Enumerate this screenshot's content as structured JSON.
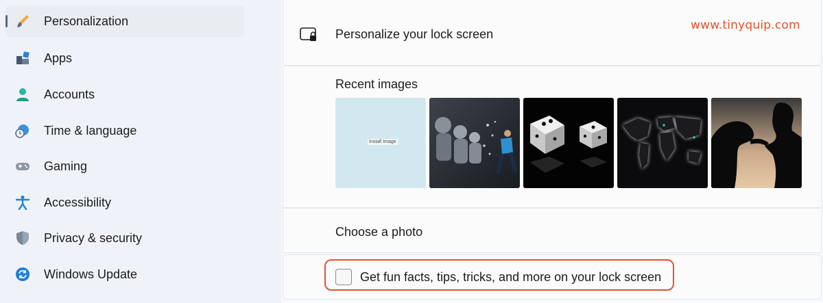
{
  "sidebar": {
    "items": [
      {
        "label": "Personalization",
        "icon": "paintbrush-icon",
        "active": true
      },
      {
        "label": "Apps",
        "icon": "apps-icon"
      },
      {
        "label": "Accounts",
        "icon": "person-icon"
      },
      {
        "label": "Time & language",
        "icon": "globe-clock-icon"
      },
      {
        "label": "Gaming",
        "icon": "gamepad-icon"
      },
      {
        "label": "Accessibility",
        "icon": "accessibility-icon"
      },
      {
        "label": "Privacy & security",
        "icon": "shield-icon"
      },
      {
        "label": "Windows Update",
        "icon": "sync-icon"
      }
    ]
  },
  "main": {
    "title": "Personalize your lock screen",
    "watermark": "www.tinyquip.com",
    "recent_images_label": "Recent images",
    "thumbnail_caption": "Install Image",
    "choose_label": "Choose a photo",
    "fun_facts": {
      "label": "Get fun facts, tips, tricks, and more on your lock screen",
      "checked": false
    }
  },
  "colors": {
    "accent_highlight": "#e25232",
    "sidebar_background": "#eff3f9"
  }
}
